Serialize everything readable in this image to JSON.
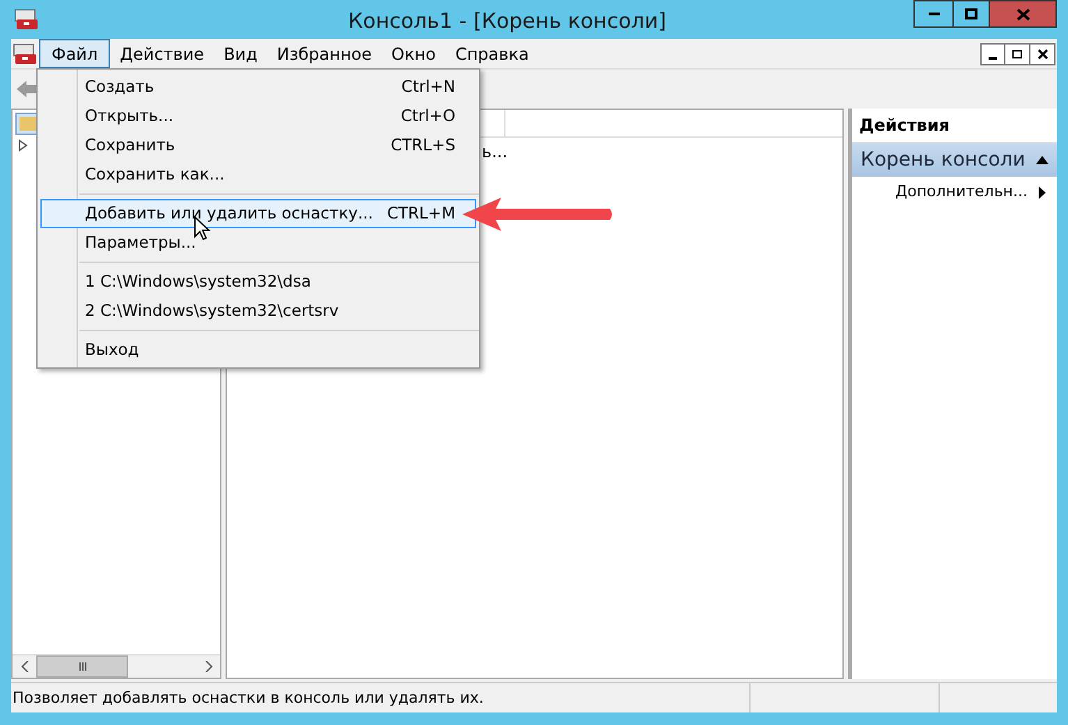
{
  "window": {
    "title": "Консоль1 - [Корень консоли]"
  },
  "menu_bar": [
    {
      "label": "Файл",
      "selected": true
    },
    {
      "label": "Действие",
      "selected": false
    },
    {
      "label": "Вид",
      "selected": false
    },
    {
      "label": "Избранное",
      "selected": false
    },
    {
      "label": "Окно",
      "selected": false
    },
    {
      "label": "Справка",
      "selected": false
    }
  ],
  "file_menu": [
    {
      "kind": "item",
      "label": "Создать",
      "shortcut": "Ctrl+N",
      "selected": false
    },
    {
      "kind": "item",
      "label": "Открыть...",
      "shortcut": "Ctrl+O",
      "selected": false
    },
    {
      "kind": "item",
      "label": "Сохранить",
      "shortcut": "CTRL+S",
      "selected": false
    },
    {
      "kind": "item",
      "label": "Сохранить как...",
      "selected": false
    },
    {
      "kind": "separator"
    },
    {
      "kind": "item",
      "label": "Добавить или удалить оснастку...",
      "shortcut": "CTRL+M",
      "selected": true
    },
    {
      "kind": "item",
      "label": "Параметры...",
      "selected": false
    },
    {
      "kind": "separator"
    },
    {
      "kind": "item",
      "label": "1 C:\\Windows\\system32\\dsa",
      "selected": false
    },
    {
      "kind": "item",
      "label": "2 C:\\Windows\\system32\\certsrv",
      "selected": false
    },
    {
      "kind": "separator"
    },
    {
      "kind": "item",
      "label": "Выход",
      "selected": false
    }
  ],
  "center_pane": {
    "partial_text": "ь..."
  },
  "actions_pane": {
    "title": "Действия",
    "section": "Корень консоли",
    "items": [
      "Дополнительн..."
    ]
  },
  "status_bar": {
    "text": "Позволяет добавлять оснастки в консоль или удалять их."
  }
}
